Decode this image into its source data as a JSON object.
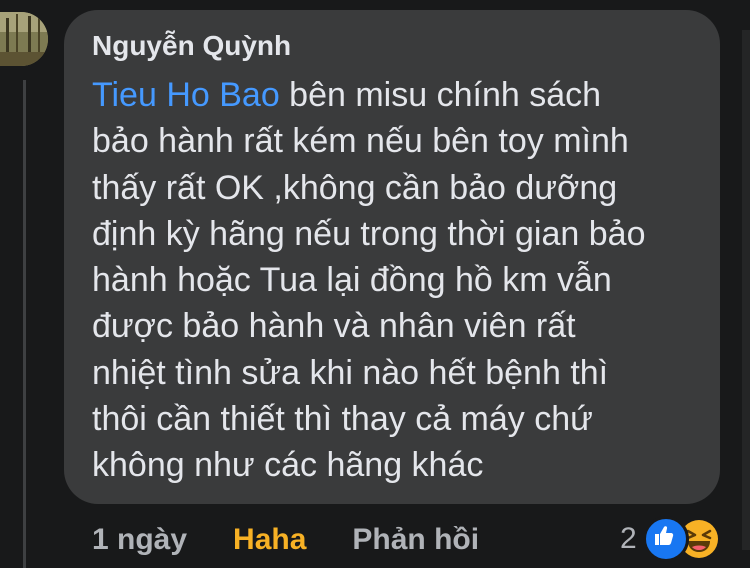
{
  "comment": {
    "author": "Nguyễn Quỳnh",
    "mention": "Tieu Ho Bao",
    "lines": [
      " bên misu chính sách",
      "bảo hành rất kém nếu bên toy mình",
      "thấy rất OK ,không cần bảo dưỡng",
      "định kỳ hãng nếu trong thời gian bảo",
      "hành hoặc Tua lại đồng hồ km vẫn",
      "được bảo hành và nhân viên rất",
      "nhiệt tình sửa khi nào hết bệnh thì",
      "thôi cần thiết thì thay cả máy chứ",
      "không như các hãng khác"
    ]
  },
  "actions": {
    "time": "1 ngày",
    "reaction_label": "Haha",
    "reply_label": "Phản hồi"
  },
  "reactions": {
    "count": "2",
    "icons": [
      "like-icon",
      "haha-icon"
    ]
  },
  "colors": {
    "background": "#18191a",
    "bubble": "#3a3b3c",
    "text": "#e4e6eb",
    "mention": "#4599ff",
    "haha": "#f7b125",
    "muted": "#b0b3b8",
    "like": "#1877f2"
  }
}
